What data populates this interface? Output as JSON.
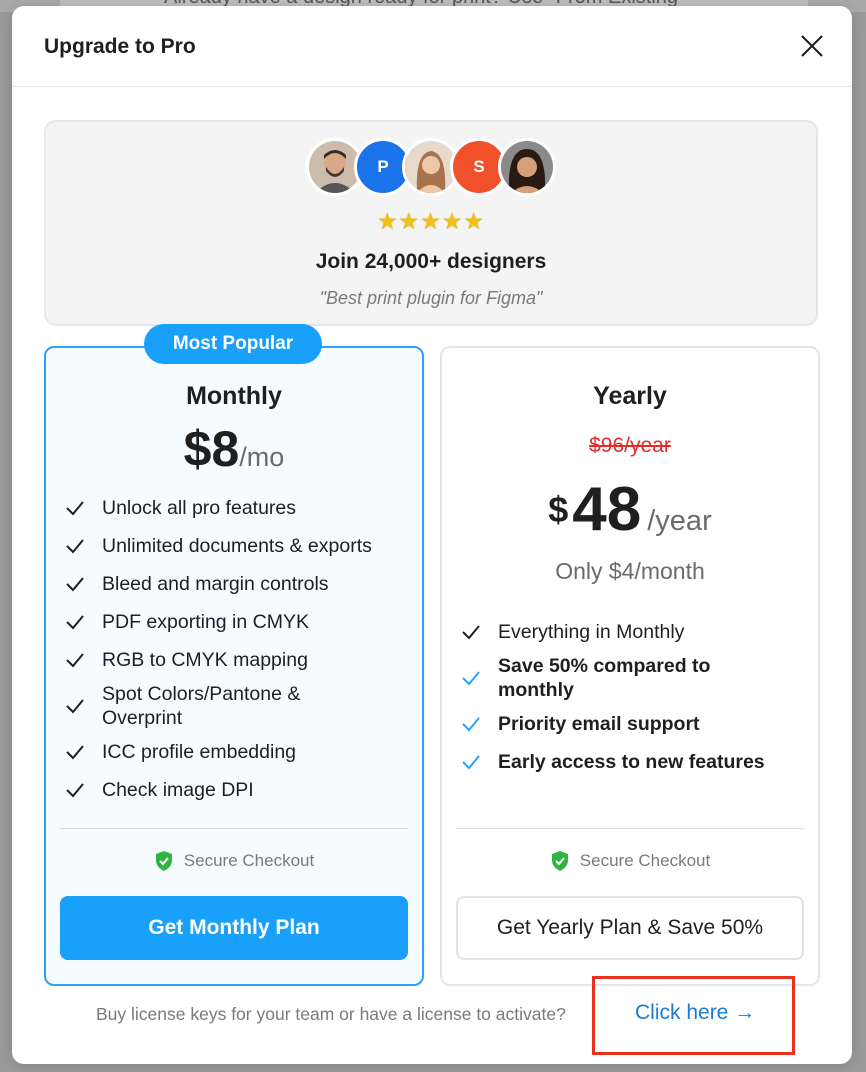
{
  "background": {
    "text": "Already have a design ready for print? Use \"From Existing"
  },
  "modal": {
    "title": "Upgrade to Pro",
    "close_icon": "close-icon"
  },
  "social_proof": {
    "avatars": [
      {
        "type": "photo",
        "initial": "",
        "color": "#c9b7a6"
      },
      {
        "type": "initial",
        "initial": "P",
        "color": "#1a73e8"
      },
      {
        "type": "photo",
        "initial": "",
        "color": "#d9a98a"
      },
      {
        "type": "initial",
        "initial": "S",
        "color": "#f0512a"
      },
      {
        "type": "photo",
        "initial": "",
        "color": "#6b4a3a"
      }
    ],
    "rating": 5,
    "stars": "★★★★★",
    "headline": "Join 24,000+ designers",
    "quote": "\"Best print plugin for Figma\""
  },
  "plans": {
    "monthly": {
      "badge": "Most Popular",
      "name": "Monthly",
      "price": "$8",
      "unit": "/mo",
      "features": [
        {
          "text": "Unlock all pro features",
          "style": "normal"
        },
        {
          "text": "Unlimited documents & exports",
          "style": "normal"
        },
        {
          "text": "Bleed and margin controls",
          "style": "normal"
        },
        {
          "text": "PDF exporting in CMYK",
          "style": "normal"
        },
        {
          "text": "RGB to CMYK mapping",
          "style": "normal"
        },
        {
          "text": "Spot Colors/Pantone & Overprint",
          "style": "normal"
        },
        {
          "text": "ICC profile embedding",
          "style": "normal"
        },
        {
          "text": "Check image DPI",
          "style": "normal"
        }
      ],
      "secure_label": "Secure Checkout",
      "cta_label": "Get Monthly Plan"
    },
    "yearly": {
      "name": "Yearly",
      "old_price": "$96/year",
      "currency": "$",
      "price": "48",
      "unit": "/year",
      "per_month": "Only $4/month",
      "features": [
        {
          "text": "Everything in Monthly",
          "style": "normal"
        },
        {
          "text": "Save 50% compared to monthly",
          "style": "highlight"
        },
        {
          "text": "Priority email support",
          "style": "highlight"
        },
        {
          "text": "Early access to new features",
          "style": "highlight"
        }
      ],
      "secure_label": "Secure Checkout",
      "cta_label": "Get Yearly Plan & Save 50%"
    }
  },
  "footer": {
    "text": "Buy license keys for your team or have a license to activate?",
    "link_label": "Click here →"
  },
  "colors": {
    "accent": "#18a0fb",
    "strike": "#e22b2b",
    "check_dark": "#1f1f1f",
    "check_blue": "#2fa0f3",
    "shield": "#2fb344",
    "annotation": "#e8321f"
  }
}
